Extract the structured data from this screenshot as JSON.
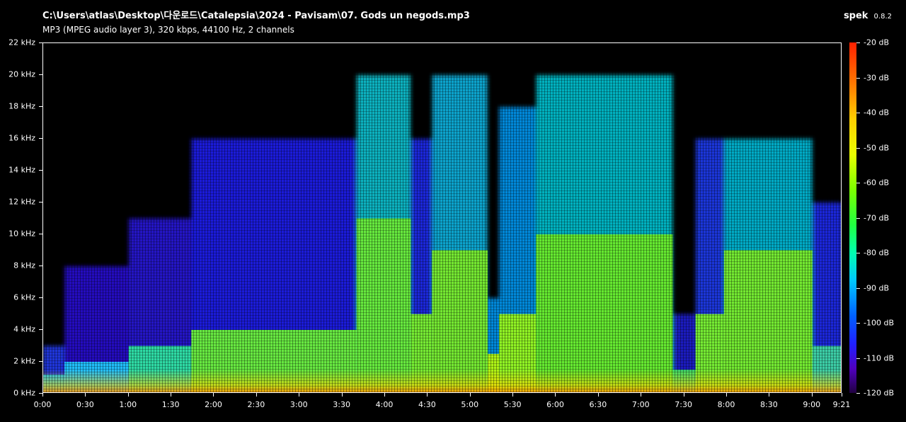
{
  "header": {
    "file_path": "C:\\Users\\atlas\\Desktop\\다운로드\\Catalepsia\\2024 - Pavisam\\07. Gods un negods.mp3",
    "file_info": "MP3 (MPEG audio layer 3), 320 kbps, 44100 Hz, 2 channels"
  },
  "app": {
    "name": "spek",
    "version": "0.8.2"
  },
  "axes": {
    "frequency_labels": [
      "22 kHz",
      "20 kHz",
      "18 kHz",
      "16 kHz",
      "14 kHz",
      "12 kHz",
      "10 kHz",
      "8 kHz",
      "6 kHz",
      "4 kHz",
      "2 kHz",
      "0 kHz"
    ],
    "frequency_values_khz": [
      22,
      20,
      18,
      16,
      14,
      12,
      10,
      8,
      6,
      4,
      2,
      0
    ],
    "time_labels": [
      "0:00",
      "0:30",
      "1:00",
      "1:30",
      "2:00",
      "2:30",
      "3:00",
      "3:30",
      "4:00",
      "4:30",
      "5:00",
      "5:30",
      "6:00",
      "6:30",
      "7:00",
      "7:30",
      "8:00",
      "8:30",
      "9:00",
      "9:21"
    ],
    "time_values_s": [
      0,
      30,
      60,
      90,
      120,
      150,
      180,
      210,
      240,
      270,
      300,
      330,
      360,
      390,
      420,
      450,
      480,
      510,
      540,
      561
    ],
    "duration_s": 561,
    "max_freq_khz": 22
  },
  "colorbar": {
    "labels": [
      "-20 dB",
      "-30 dB",
      "-40 dB",
      "-50 dB",
      "-60 dB",
      "-70 dB",
      "-80 dB",
      "-90 dB",
      "-100 dB",
      "-110 dB",
      "-120 dB"
    ],
    "values_db": [
      -20,
      -30,
      -40,
      -50,
      -60,
      -70,
      -80,
      -90,
      -100,
      -110,
      -120
    ],
    "max_db": -20,
    "min_db": -120
  },
  "spectrogram": {
    "segments": [
      {
        "t0": 0,
        "t1": 15,
        "top_khz": 3,
        "color": "#2440ff",
        "core_khz": 1.2,
        "core_color": "#10c8ff"
      },
      {
        "t0": 15,
        "t1": 60,
        "top_khz": 8,
        "color": "#2a10e0",
        "core_khz": 2,
        "core_color": "#20d0ff"
      },
      {
        "t0": 60,
        "t1": 104,
        "top_khz": 11,
        "color": "#2818e8",
        "core_khz": 3,
        "core_color": "#30f0a0"
      },
      {
        "t0": 104,
        "t1": 220,
        "top_khz": 16,
        "color": "#2020ff",
        "core_khz": 4,
        "core_color": "#70ff30"
      },
      {
        "t0": 220,
        "t1": 258,
        "top_khz": 20,
        "color": "#10d0e0",
        "core_khz": 11,
        "core_color": "#70f030"
      },
      {
        "t0": 258,
        "t1": 273,
        "top_khz": 16,
        "color": "#2030ff",
        "core_khz": 5,
        "core_color": "#80ff20"
      },
      {
        "t0": 273,
        "t1": 312,
        "top_khz": 20,
        "color": "#10c0f0",
        "core_khz": 9,
        "core_color": "#80f020"
      },
      {
        "t0": 312,
        "t1": 320,
        "top_khz": 6,
        "color": "#00a0ff",
        "core_khz": 2.5,
        "core_color": "#c0ff00"
      },
      {
        "t0": 320,
        "t1": 346,
        "top_khz": 18,
        "color": "#00a0ff",
        "core_khz": 5,
        "core_color": "#a0ff10"
      },
      {
        "t0": 346,
        "t1": 442,
        "top_khz": 20,
        "color": "#00d0e0",
        "core_khz": 10,
        "core_color": "#70f020"
      },
      {
        "t0": 442,
        "t1": 458,
        "top_khz": 5,
        "color": "#2020e0",
        "core_khz": 1.5,
        "core_color": "#40f060"
      },
      {
        "t0": 458,
        "t1": 478,
        "top_khz": 16,
        "color": "#2040ff",
        "core_khz": 5,
        "core_color": "#80ff20"
      },
      {
        "t0": 478,
        "t1": 540,
        "top_khz": 16,
        "color": "#00c8e8",
        "core_khz": 9,
        "core_color": "#80f020"
      },
      {
        "t0": 540,
        "t1": 561,
        "top_khz": 12,
        "color": "#2030ff",
        "core_khz": 3,
        "core_color": "#40e0a0"
      }
    ]
  }
}
